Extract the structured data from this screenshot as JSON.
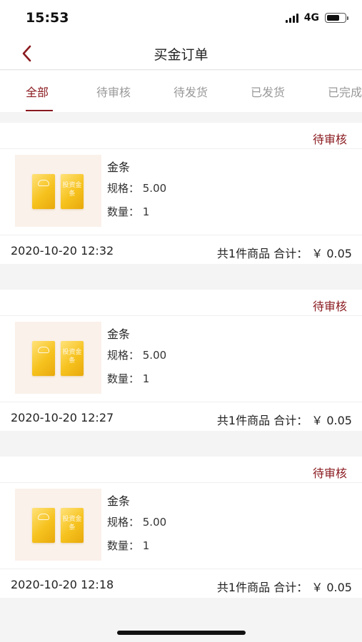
{
  "status_bar": {
    "time": "15:53",
    "network": "4G",
    "icons": [
      "signal-icon",
      "battery-icon"
    ]
  },
  "header": {
    "title": "买金订单",
    "back_icon": "chevron-left-icon"
  },
  "tabs": [
    {
      "label": "全部",
      "active": true
    },
    {
      "label": "待审核",
      "active": false
    },
    {
      "label": "待发货",
      "active": false
    },
    {
      "label": "已发货",
      "active": false
    },
    {
      "label": "已完成",
      "active": false
    }
  ],
  "colors": {
    "accent": "#8a1a1f",
    "gold": "#f6c21e"
  },
  "orders": [
    {
      "status": "待审核",
      "product": {
        "name": "金条",
        "spec": "规格： 5.00",
        "quantity": "数量： 1",
        "bar_mark": "投资金条"
      },
      "time": "2020-10-20 12:32",
      "summary": "共1件商品 合计： ￥ 0.05"
    },
    {
      "status": "待审核",
      "product": {
        "name": "金条",
        "spec": "规格： 5.00",
        "quantity": "数量： 1",
        "bar_mark": "投资金条"
      },
      "time": "2020-10-20 12:27",
      "summary": "共1件商品 合计： ￥ 0.05"
    },
    {
      "status": "待审核",
      "product": {
        "name": "金条",
        "spec": "规格： 5.00",
        "quantity": "数量： 1",
        "bar_mark": "投资金条"
      },
      "time": "2020-10-20 12:18",
      "summary": "共1件商品 合计： ￥ 0.05"
    }
  ]
}
